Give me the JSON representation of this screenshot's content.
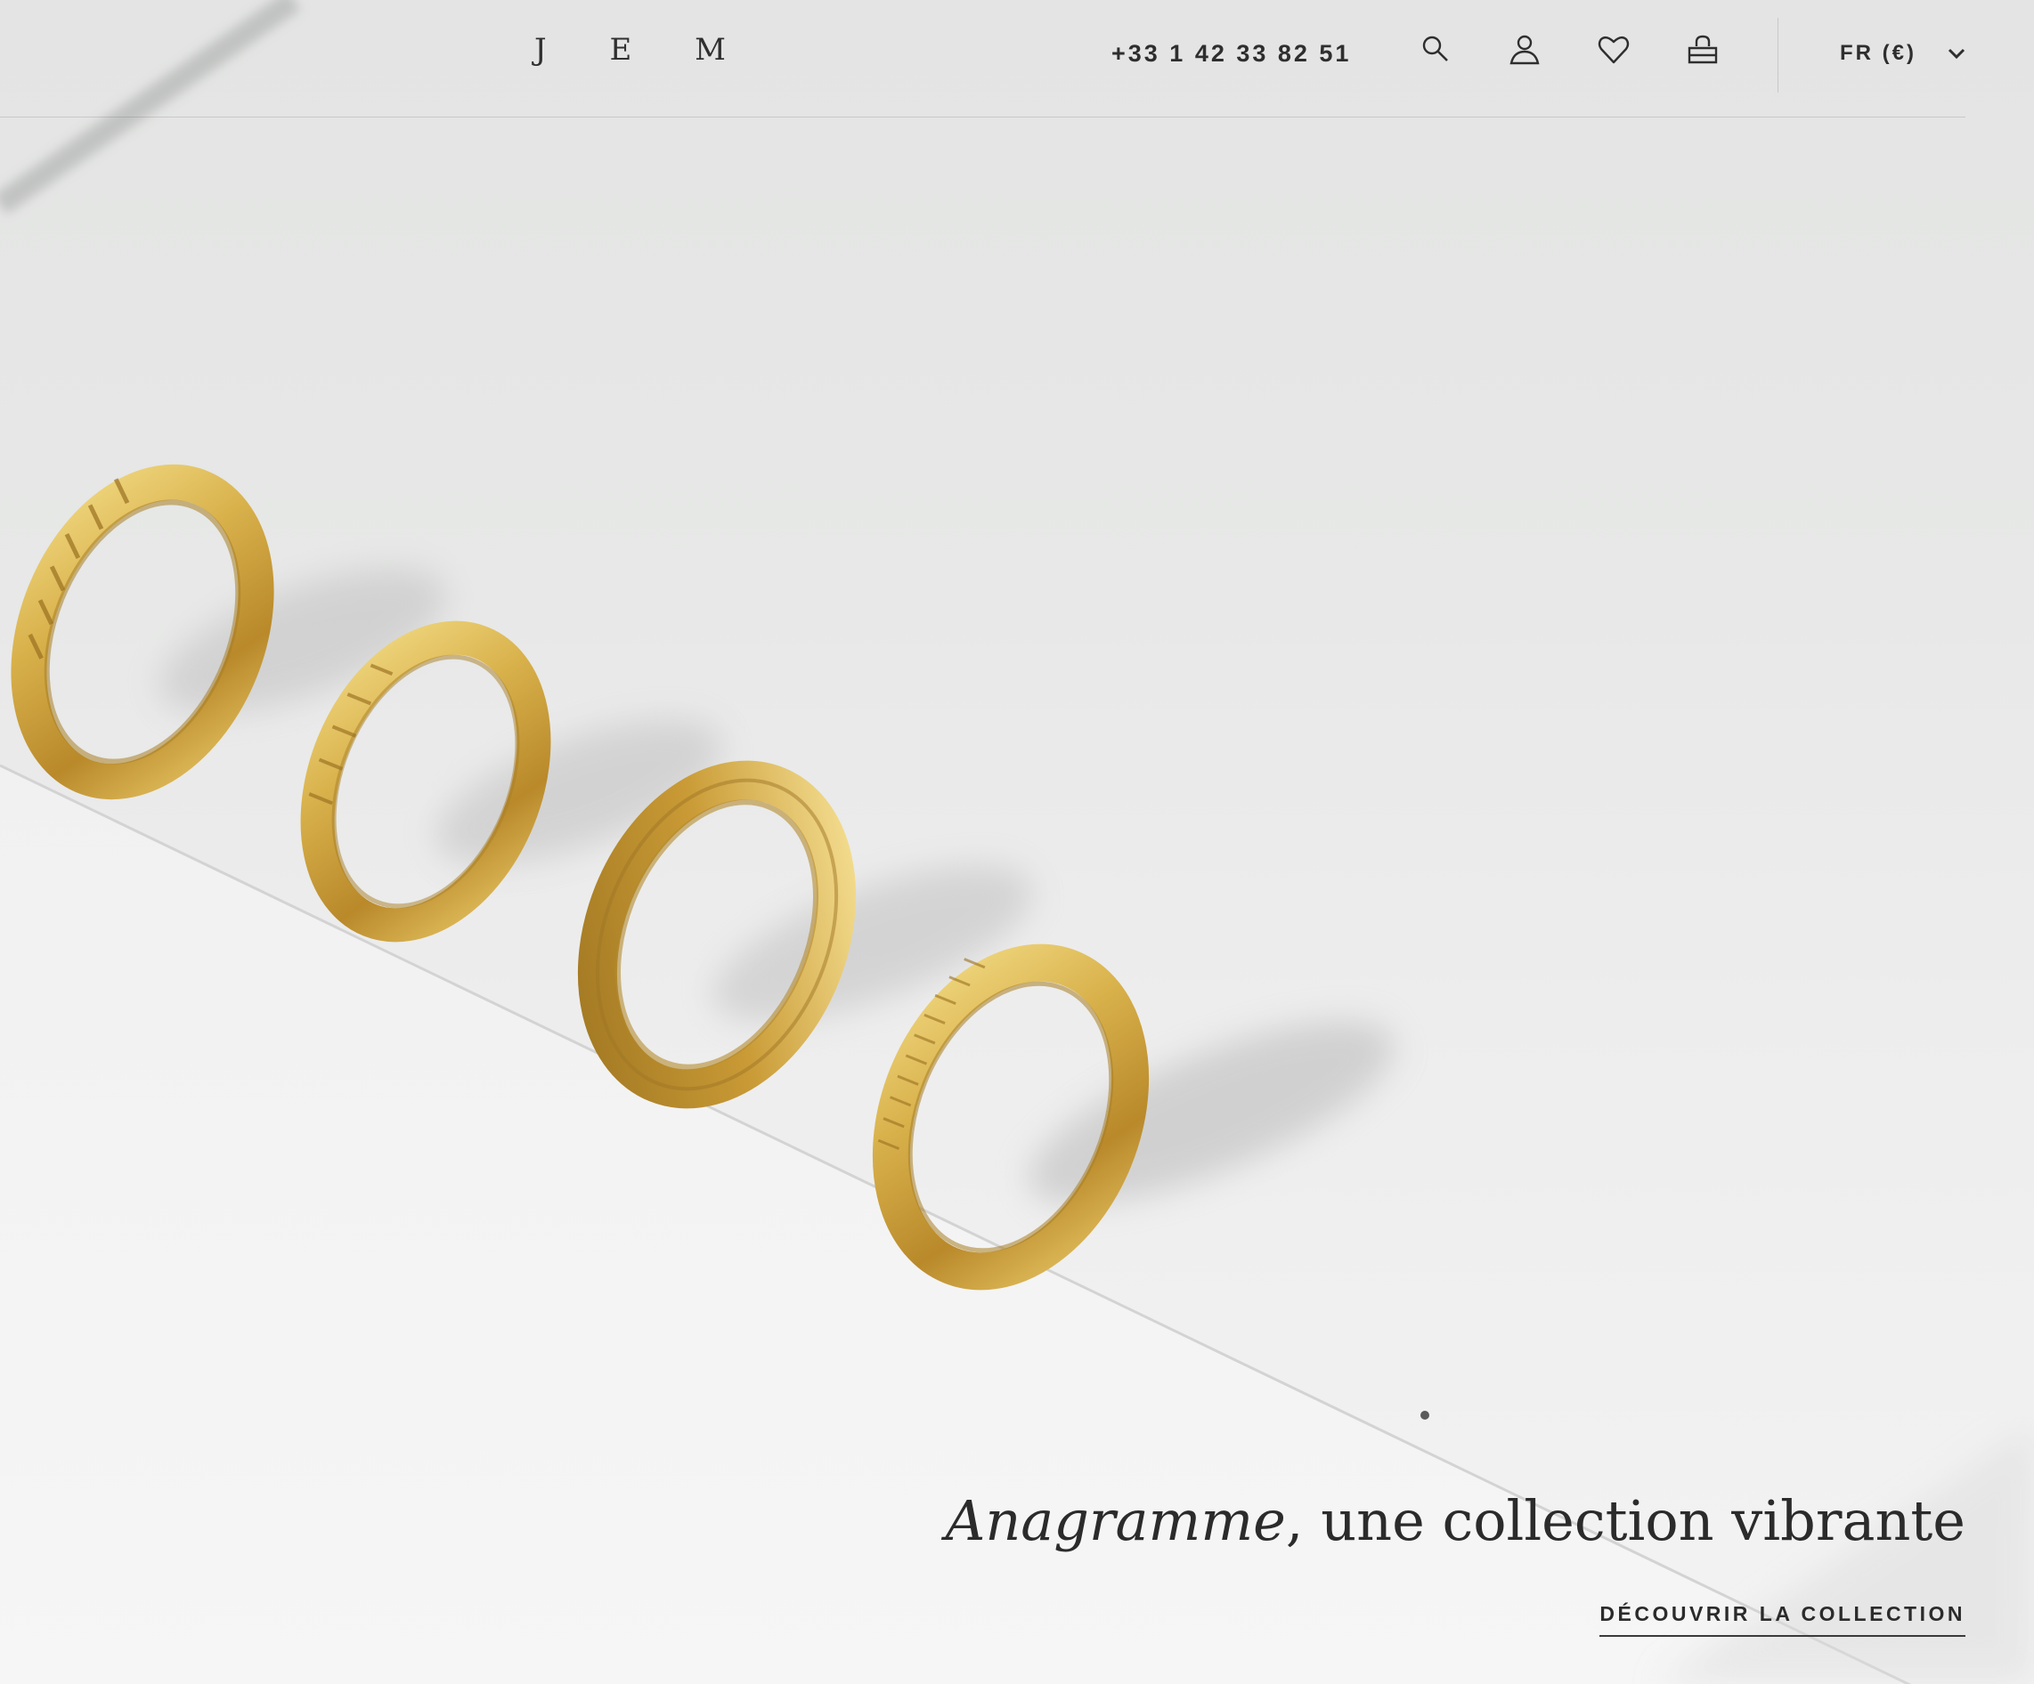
{
  "header": {
    "logo": "J E M",
    "phone": "+33 1 42 33 82 51",
    "icons": [
      "search-icon",
      "account-icon",
      "wishlist-icon",
      "bag-icon"
    ],
    "locale": "FR (€)"
  },
  "hero": {
    "title_italic": "Anagramme",
    "title_rest": ", une collection vibrante",
    "cta_label": "DÉCOUVRIR LA COLLECTION",
    "image_description_colors": {
      "background": "#e8e8e8",
      "gold": "#d8b24e",
      "text": "#2b2b2b"
    }
  }
}
